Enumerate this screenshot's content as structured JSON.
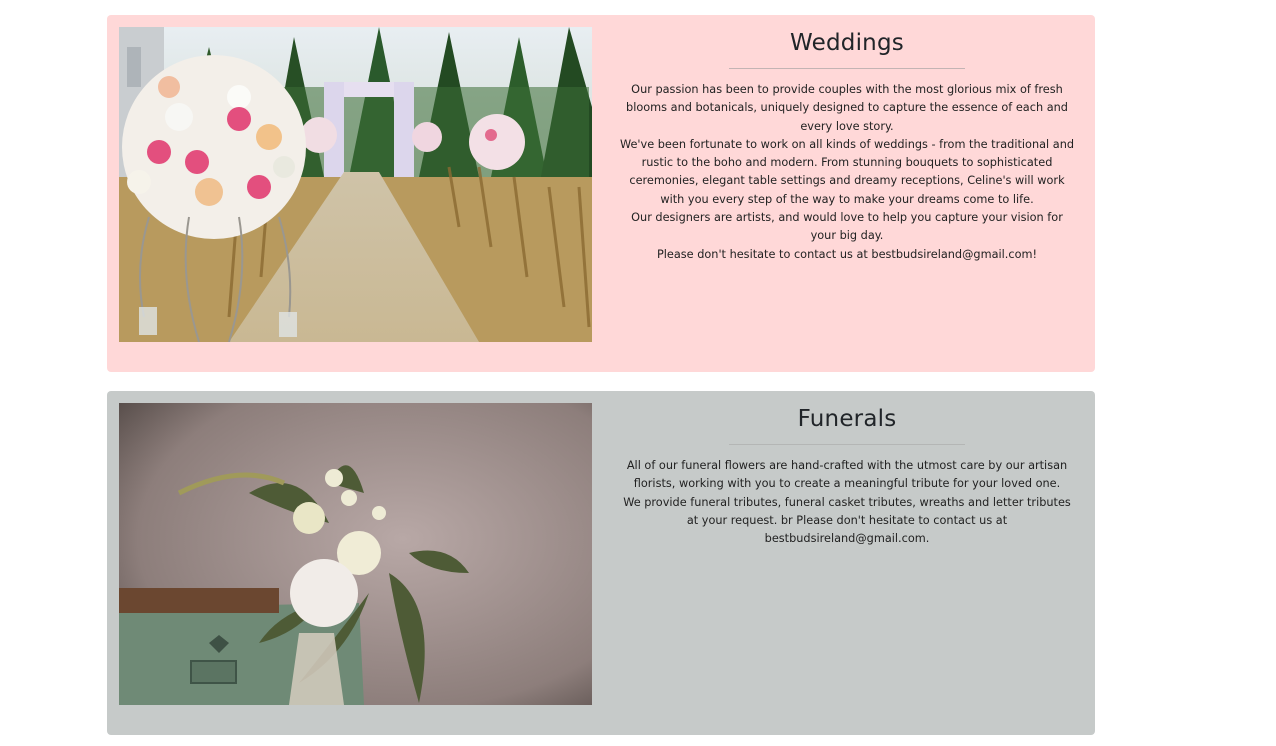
{
  "sections": [
    {
      "id": "weddings",
      "title": "Weddings",
      "paragraphs": [
        "Our passion has been to provide couples with the most glorious mix of fresh blooms and botanicals, uniquely designed to capture the essence of each and every love story.",
        "We've been fortunate to work on all kinds of weddings - from the traditional and rustic to the boho and modern. From stunning bouquets to sophisticated ceremonies, elegant table settings and dreamy receptions, Celine's will work with you every step of the way to make your dreams come to life.",
        "Our designers are artists, and would love to help you capture your vision for your big day.",
        "Please don't hesitate to contact us at bestbudsireland@gmail.com!"
      ],
      "background": "#ffd8d8",
      "image": "wedding-aisle-flowers-photo"
    },
    {
      "id": "funerals",
      "title": "Funerals",
      "paragraphs": [
        "All of our funeral flowers are hand-crafted with the utmost care by our artisan florists, working with you to create a meaningful tribute for your loved one.",
        "We provide funeral tributes, funeral casket tributes, wreaths and letter tributes at your request. br Please don't hesitate to contact us at bestbudsireland@gmail.com."
      ],
      "background": "#c6cac9",
      "image": "funeral-bouquet-photo"
    }
  ]
}
